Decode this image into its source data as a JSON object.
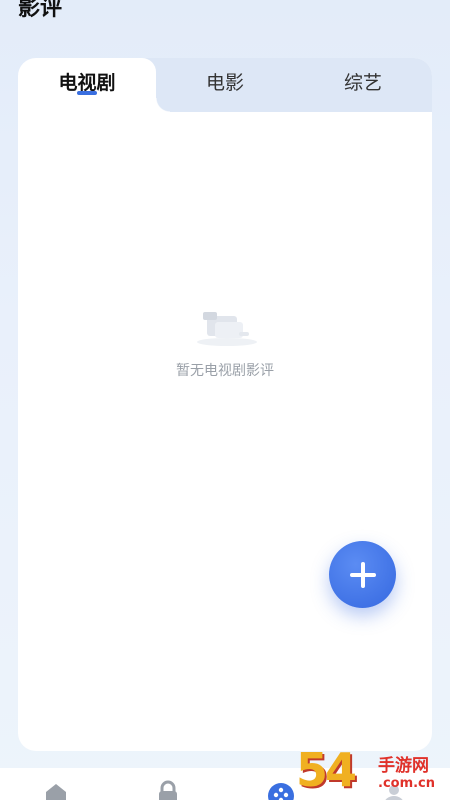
{
  "header": {
    "title": "影评"
  },
  "tabs": [
    {
      "label": "电视剧",
      "active": true
    },
    {
      "label": "电影",
      "active": false
    },
    {
      "label": "综艺",
      "active": false
    }
  ],
  "empty_state": {
    "text": "暂无电视剧影评",
    "icon": "empty-box-icon"
  },
  "fab": {
    "icon": "plus-icon"
  },
  "bottom_nav": {
    "items": [
      {
        "icon": "home-icon"
      },
      {
        "icon": "lock-icon"
      },
      {
        "icon": "game-icon"
      },
      {
        "icon": "profile-icon"
      }
    ]
  },
  "watermark": {
    "number": "54",
    "name": "手游网",
    "url": ".com.cn"
  },
  "colors": {
    "accent": "#3a6fe0",
    "tab_bg": "#dde7f6",
    "card": "#ffffff"
  }
}
